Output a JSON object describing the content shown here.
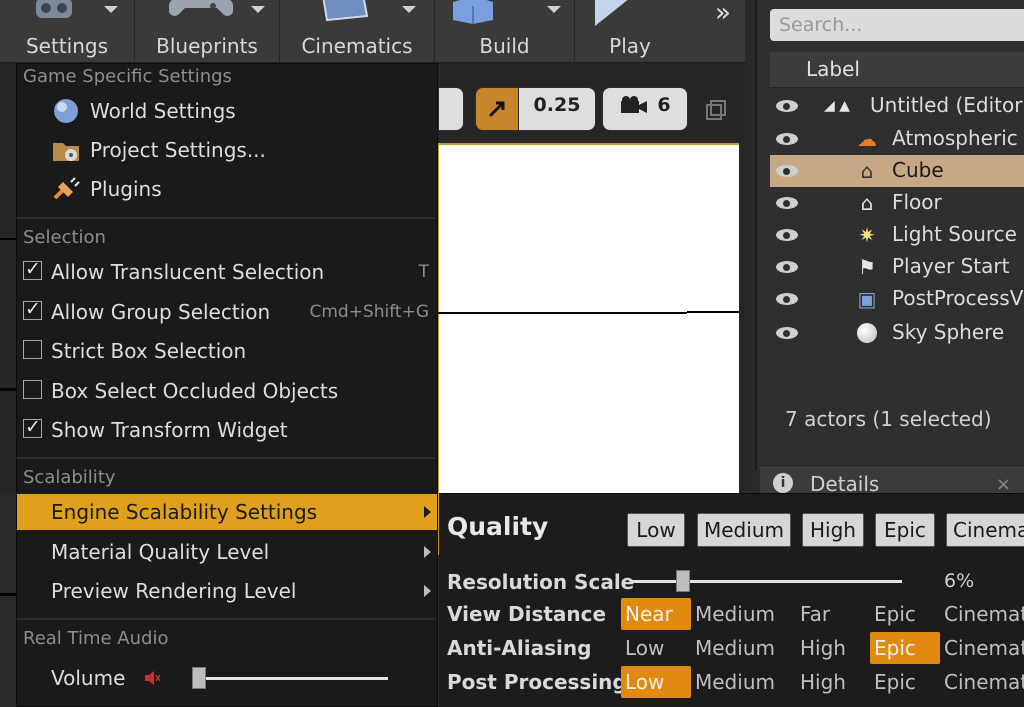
{
  "toolbar": {
    "buttons": [
      {
        "label": "Settings"
      },
      {
        "label": "Blueprints"
      },
      {
        "label": "Cinematics"
      },
      {
        "label": "Build"
      },
      {
        "label": "Play"
      }
    ],
    "more": "»"
  },
  "viewport": {
    "snap_scale": "0.25",
    "camera_speed": "6"
  },
  "outliner": {
    "search_placeholder": "Search...",
    "column_label": "Label",
    "rows": [
      {
        "name": "Untitled (Editor)",
        "icon": "level-icon"
      },
      {
        "name": "Atmospheric F",
        "icon": "atmospheric-fog-icon"
      },
      {
        "name": "Cube",
        "icon": "static-mesh-icon"
      },
      {
        "name": "Floor",
        "icon": "static-mesh-icon"
      },
      {
        "name": "Light Source",
        "icon": "directional-light-icon"
      },
      {
        "name": "Player Start",
        "icon": "player-start-icon"
      },
      {
        "name": "PostProcessV",
        "icon": "post-process-volume-icon"
      },
      {
        "name": "Sky Sphere",
        "icon": "sphere-icon"
      }
    ],
    "selected": "Cube",
    "footer": "7 actors (1 selected)"
  },
  "details": {
    "label": "Details",
    "close": "×"
  },
  "menu": {
    "sections": {
      "game": "Game Specific Settings",
      "selection": "Selection",
      "scalability": "Scalability",
      "audio": "Real Time Audio"
    },
    "game_items": [
      {
        "label": "World Settings",
        "icon": "globe-icon"
      },
      {
        "label": "Project Settings...",
        "icon": "folder-gear-icon"
      },
      {
        "label": "Plugins",
        "icon": "plug-icon"
      }
    ],
    "selection_items": [
      {
        "label": "Allow Translucent Selection",
        "checked": true,
        "shortcut": "T"
      },
      {
        "label": "Allow Group Selection",
        "checked": true,
        "shortcut": "Cmd+Shift+G"
      },
      {
        "label": "Strict Box Selection",
        "checked": false,
        "shortcut": ""
      },
      {
        "label": "Box Select Occluded Objects",
        "checked": false,
        "shortcut": ""
      },
      {
        "label": "Show Transform Widget",
        "checked": true,
        "shortcut": ""
      }
    ],
    "scalability_items": [
      {
        "label": "Engine Scalability Settings",
        "highlighted": true
      },
      {
        "label": "Material Quality Level",
        "highlighted": false
      },
      {
        "label": "Preview Rendering Level",
        "highlighted": false
      }
    ],
    "volume_label": "Volume",
    "volume_level": 0.0
  },
  "scalability": {
    "title": "Quality",
    "presets": [
      "Low",
      "Medium",
      "High",
      "Epic",
      "Cinema"
    ],
    "resolution_label": "Resolution Scale",
    "resolution_value": "6%",
    "resolution_level": 0.19,
    "rows": [
      {
        "label": "View Distance",
        "options": [
          "Near",
          "Medium",
          "Far",
          "Epic",
          "Cinemat"
        ],
        "selected": 0
      },
      {
        "label": "Anti-Aliasing",
        "options": [
          "Low",
          "Medium",
          "High",
          "Epic",
          "Cinemat"
        ],
        "selected": 3
      },
      {
        "label": "Post Processing",
        "options": [
          "Low",
          "Medium",
          "High",
          "Epic",
          "Cinemat"
        ],
        "selected": 0
      }
    ]
  },
  "colors": {
    "menu_highlight": "#e0a01c",
    "option_selected": "#e08a10",
    "outliner_selected": "#c7a884"
  }
}
